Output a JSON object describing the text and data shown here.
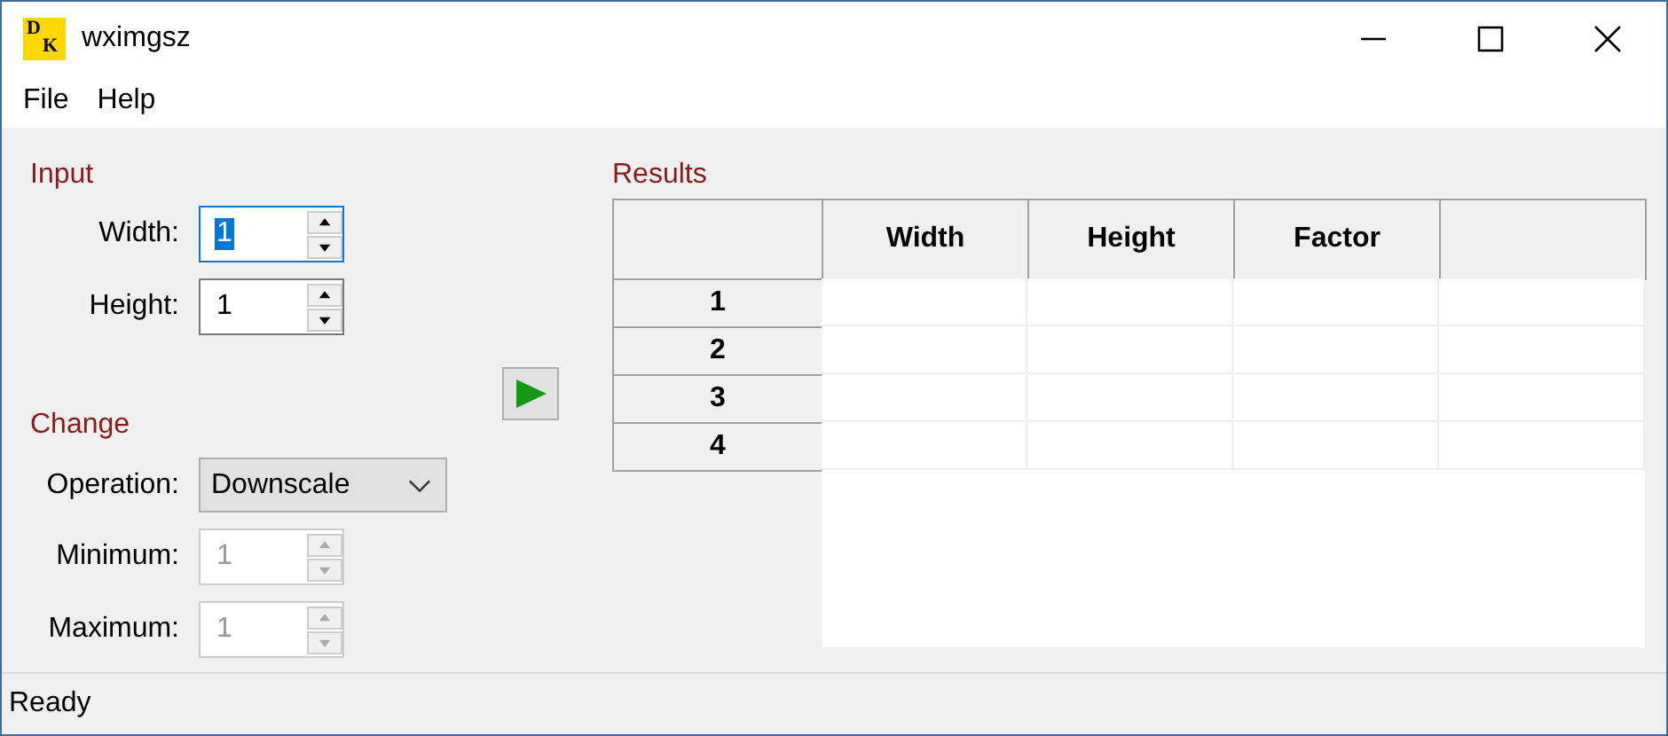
{
  "window": {
    "title": "wximgsz",
    "logo_letters": [
      "D",
      "K"
    ]
  },
  "menu": [
    "File",
    "Help"
  ],
  "input": {
    "heading": "Input",
    "fields": [
      {
        "label": "Width:",
        "value": "1",
        "focused": true,
        "disabled": false
      },
      {
        "label": "Height:",
        "value": "1",
        "focused": false,
        "disabled": false
      }
    ]
  },
  "change": {
    "heading": "Change",
    "operation": {
      "label": "Operation:",
      "value": "Downscale"
    },
    "fields": [
      {
        "label": "Minimum:",
        "value": "1",
        "focused": false,
        "disabled": true
      },
      {
        "label": "Maximum:",
        "value": "1",
        "focused": false,
        "disabled": true
      }
    ]
  },
  "results": {
    "heading": "Results",
    "columns": [
      "Width",
      "Height",
      "Factor"
    ],
    "rows": [
      "1",
      "2",
      "3",
      "4"
    ]
  },
  "status_bar": "Ready"
}
